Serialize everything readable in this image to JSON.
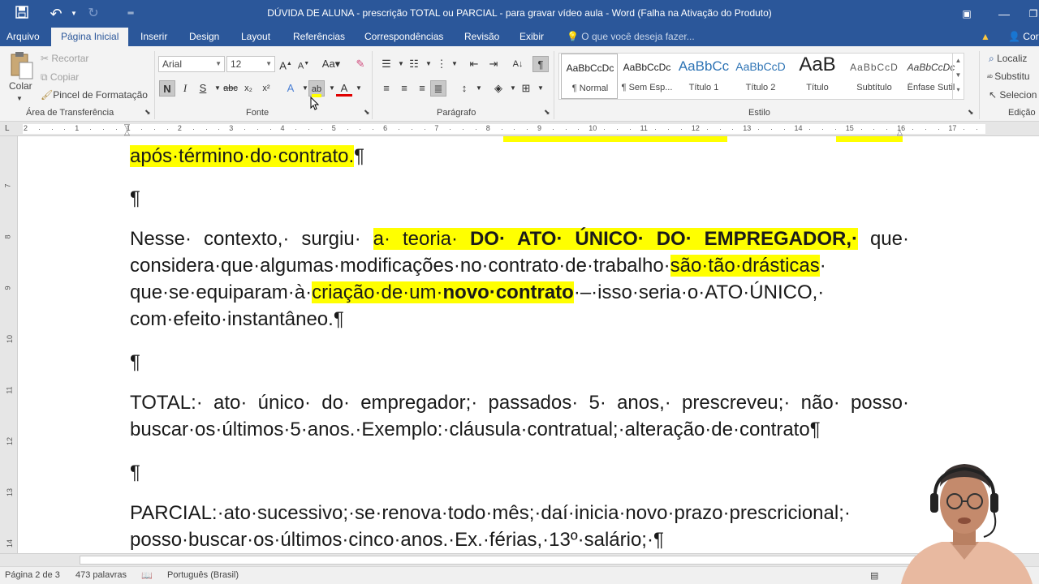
{
  "window": {
    "title": "DÚVIDA DE ALUNA - prescrição TOTAL ou PARCIAL - para gravar vídeo aula - Word (Falha na Ativação do Produto)"
  },
  "tabs": [
    {
      "label": "Arquivo"
    },
    {
      "label": "Página Inicial"
    },
    {
      "label": "Inserir"
    },
    {
      "label": "Design"
    },
    {
      "label": "Layout"
    },
    {
      "label": "Referências"
    },
    {
      "label": "Correspondências"
    },
    {
      "label": "Revisão"
    },
    {
      "label": "Exibir"
    }
  ],
  "tell_me": "O que você deseja fazer...",
  "share_label": "Cor",
  "clipboard": {
    "paste": "Colar",
    "cut": "Recortar",
    "copy": "Copiar",
    "painter": "Pincel de Formatação",
    "group": "Área de Transferência"
  },
  "font": {
    "name": "Arial",
    "size": "12",
    "group": "Fonte",
    "bold": "N",
    "italic": "I",
    "underline": "S"
  },
  "paragraph": {
    "group": "Parágrafo"
  },
  "styles": {
    "group": "Estilo",
    "items": [
      {
        "preview": "AaBbCcDc",
        "name": "¶ Normal"
      },
      {
        "preview": "AaBbCcDc",
        "name": "¶ Sem Esp..."
      },
      {
        "preview": "AaBbCc",
        "name": "Título 1"
      },
      {
        "preview": "AaBbCcD",
        "name": "Título 2"
      },
      {
        "preview": "AaB",
        "name": "Título"
      },
      {
        "preview": "AaBbCcD",
        "name": "Subtítulo"
      },
      {
        "preview": "AaBbCcDc",
        "name": "Ênfase Sutil"
      }
    ]
  },
  "editing": {
    "find": "Localiz",
    "replace": "Substitu",
    "select": "Selecion",
    "group": "Edição"
  },
  "ruler": {
    "h_numbers": [
      "2",
      "1",
      "1",
      "2",
      "3",
      "4",
      "5",
      "6",
      "7",
      "8",
      "9",
      "10",
      "11",
      "12",
      "13",
      "14",
      "15",
      "16",
      "17"
    ],
    "v_numbers": [
      "7",
      "8",
      "9",
      "10",
      "11",
      "12",
      "13",
      "14"
    ]
  },
  "document": {
    "p1": "após·término·do·contrato.",
    "pilcrow": "¶",
    "p2": {
      "a": "Nesse· contexto,· surgiu· ",
      "b": "a· teoria· ",
      "c": "DO· ATO· ÚNICO· DO· EMPREGADOR,·",
      "d": " que· considera·que·algumas·modificações·no·contrato·de·trabalho·",
      "e": "são·tão·drásticas",
      "f": "· que·se·equiparam·à·",
      "g": "criação·de·um·",
      "h": "novo·contrato",
      "i": "·–·isso·seria·o·ATO·ÚNICO,· com·efeito·instantâneo."
    },
    "p3": "TOTAL:· ato· único· do· empregador;· passados· 5· anos,· prescreveu;· não· posso· buscar·os·últimos·5·anos.·Exemplo:·cláusula·contratual;·alteração·de·contrato",
    "p4": "PARCIAL:·ato·sucessivo;·se·renova·todo·mês;·daí·inicia·novo·prazo·prescricional;· posso·buscar·os·últimos·cinco·anos.·Ex.·férias,·13º·salário;·"
  },
  "status": {
    "page": "Página 2 de 3",
    "words": "473 palavras",
    "language": "Português (Brasil)"
  },
  "colors": {
    "accent": "#2b579a",
    "highlight": "#ffff00"
  }
}
